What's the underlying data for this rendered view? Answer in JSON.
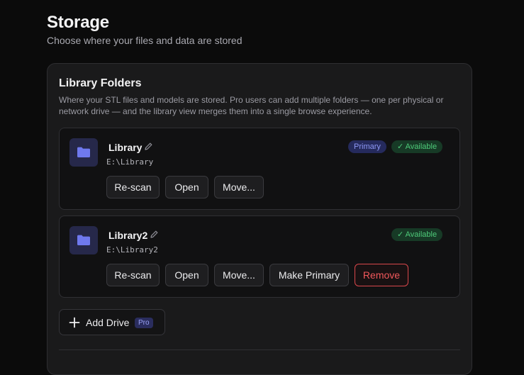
{
  "header": {
    "title": "Storage",
    "subtitle": "Choose where your files and data are stored"
  },
  "library_panel": {
    "title": "Library Folders",
    "description": "Where your STL files and models are stored. Pro users can add multiple folders — one per physical or network drive — and the library view merges them into a single browse experience.",
    "drives": [
      {
        "name": "Library",
        "path": "E:\\Library",
        "primary_badge": "Primary",
        "status": "✓ Available",
        "actions": {
          "rescan": "Re-scan",
          "open": "Open",
          "move": "Move..."
        }
      },
      {
        "name": "Library2",
        "path": "E:\\Library2",
        "status": "✓ Available",
        "actions": {
          "rescan": "Re-scan",
          "open": "Open",
          "move": "Move...",
          "make_primary": "Make Primary",
          "remove": "Remove"
        }
      }
    ],
    "add_drive": {
      "label": "Add Drive",
      "pro_badge": "Pro"
    }
  },
  "colors": {
    "background": "#0b0b0b",
    "panel": "#1a1a1b",
    "accent": "#8e98f5",
    "success": "#4ecb7a",
    "danger": "#f0585b"
  },
  "icons": [
    "folder-icon",
    "pencil-icon",
    "checkmark-icon",
    "plus-icon"
  ]
}
